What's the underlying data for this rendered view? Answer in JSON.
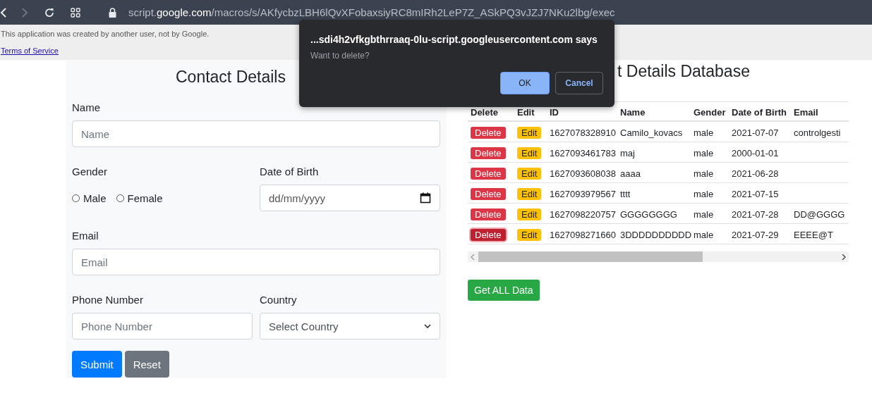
{
  "browser": {
    "url_prefix": "script.",
    "url_domain": "google.com",
    "url_path": "/macros/s/AKfycbzLBH6lQvXFobaxsiyRC8mIRh2LeP7Z_ASkPQ3vJZJ7NKu2lbg/exec"
  },
  "banner": {
    "notice": "This application was created by another user, not by Google.",
    "link": "Terms of Service"
  },
  "form": {
    "heading": "Contact Details",
    "name": {
      "label": "Name",
      "placeholder": "Name"
    },
    "gender": {
      "label": "Gender",
      "options": [
        {
          "label": "Male",
          "checked": false
        },
        {
          "label": "Female",
          "checked": false
        }
      ]
    },
    "dob": {
      "label": "Date of Birth",
      "placeholder": "dd/mm/yyyy"
    },
    "email": {
      "label": "Email",
      "placeholder": "Email"
    },
    "phone": {
      "label": "Phone Number",
      "placeholder": "Phone Number"
    },
    "country": {
      "label": "Country",
      "value": "Select Country"
    },
    "buttons": [
      {
        "label": "Submit",
        "kind": "primary"
      },
      {
        "label": "Reset",
        "kind": "secondary"
      }
    ]
  },
  "database": {
    "heading": "t Details Database",
    "columns": [
      "Delete",
      "Edit",
      "ID",
      "Name",
      "Gender",
      "Date of Birth",
      "Email"
    ],
    "rows": [
      {
        "focused": false,
        "cells": [
          "Delete",
          "Edit",
          "1627078328910",
          "Camilo_kovacs",
          "male",
          "2021-07-07",
          "controlgesti"
        ]
      },
      {
        "focused": false,
        "cells": [
          "Delete",
          "Edit",
          "1627093461783",
          "maj",
          "male",
          "2000-01-01",
          ""
        ]
      },
      {
        "focused": false,
        "cells": [
          "Delete",
          "Edit",
          "1627093608038",
          "aaaa",
          "male",
          "2021-06-28",
          ""
        ]
      },
      {
        "focused": false,
        "cells": [
          "Delete",
          "Edit",
          "1627093979567",
          "tttt",
          "male",
          "2021-07-15",
          ""
        ]
      },
      {
        "focused": false,
        "cells": [
          "Delete",
          "Edit",
          "1627098220757",
          "GGGGGGGG",
          "male",
          "2021-07-28",
          "DD@GGGG"
        ]
      },
      {
        "focused": true,
        "cells": [
          "Delete",
          "Edit",
          "1627098271660",
          "3DDDDDDDDDD",
          "male",
          "2021-07-29",
          "EEEE@T"
        ]
      }
    ],
    "get_all": "Get ALL Data"
  },
  "dialog": {
    "title": "...sdi4h2vfkgbthrraaq-0lu-script.googleusercontent.com says",
    "message": "Want to delete?",
    "ok": "OK",
    "cancel": "Cancel"
  }
}
